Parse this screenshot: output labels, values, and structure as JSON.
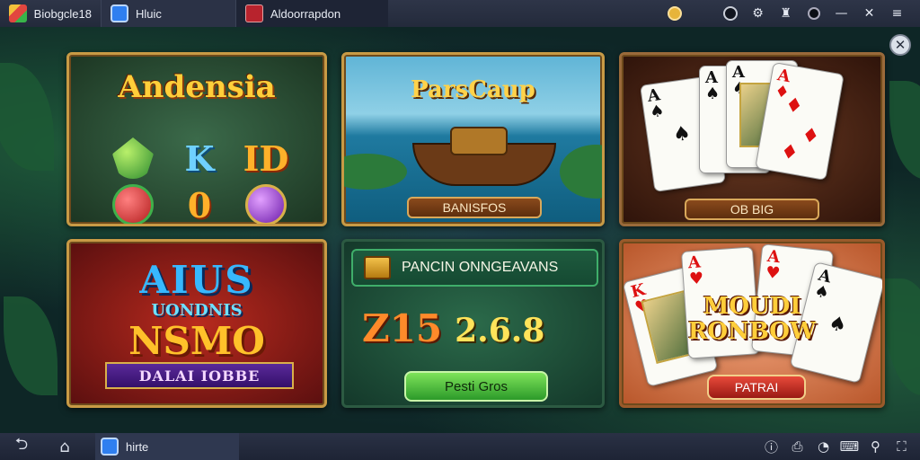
{
  "topbar": {
    "tabs": [
      {
        "label": "Biobgcle18",
        "icon": "app-logo-icon"
      },
      {
        "label": "Hluic",
        "icon": "window-icon"
      },
      {
        "label": "Aldoorrapdon",
        "icon": "app-icon"
      }
    ],
    "controls": [
      "coin-icon",
      "account-icon",
      "settings-icon",
      "notification-icon",
      "theme-icon",
      "minimize-icon",
      "close-icon"
    ]
  },
  "games": [
    {
      "title": "Andensia",
      "symbols": [
        "K",
        "ID",
        "0"
      ]
    },
    {
      "title": "ParsCaup",
      "button": "BANISFOS"
    },
    {
      "button": "OB BIG"
    },
    {
      "line1": "AIUS",
      "line2": "UONDNIS",
      "line3": "NSMO",
      "banner": "DALAI IOBBE"
    },
    {
      "header": "PANCIN ONNGEAVANS",
      "numbers_big": "Z15",
      "numbers_small": "2.6.8",
      "button": "Pesti Gros"
    },
    {
      "title_line1": "MOUDI",
      "title_line2": "RONBOW",
      "button": "PATRAI"
    }
  ],
  "bottombar": {
    "task_label": "hirte",
    "tray": [
      "info-icon",
      "screenshot-icon",
      "speed-icon",
      "keyboard-icon",
      "location-icon",
      "fullscreen-icon"
    ]
  },
  "colors": {
    "accent_gold": "#c89a45",
    "bar": "#232a3b",
    "play_green": "#2c9a2a"
  }
}
